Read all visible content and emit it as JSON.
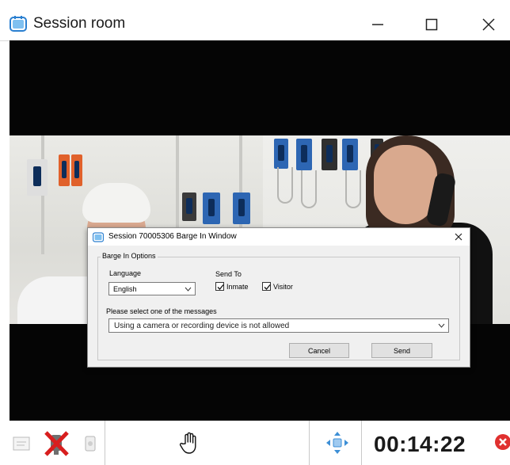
{
  "window": {
    "title": "Session room",
    "minimize_glyph": "—",
    "maximize_glyph": "☐",
    "close_glyph": "✕"
  },
  "dialog": {
    "title": "Session 70005306 Barge In Window",
    "close_glyph": "✕",
    "group_label": "Barge In Options",
    "language_label": "Language",
    "language_value": "English",
    "send_to_label": "Send To",
    "inmate_label": "Inmate",
    "inmate_checked": true,
    "visitor_label": "Visitor",
    "visitor_checked": true,
    "message_prompt": "Please select one of the messages",
    "message_value": "Using a camera or recording device is not allowed",
    "cancel_label": "Cancel",
    "send_label": "Send"
  },
  "toolbar": {
    "timer": "00:14:22",
    "icons": [
      "note-icon",
      "camera-muted-icon",
      "recording-icon",
      "hand-icon",
      "move-arrows-icon",
      "end-session-icon"
    ]
  },
  "colors": {
    "video_bg": "#050505",
    "dialog_bg": "#f0f0f0",
    "end_red": "#e0302f",
    "mute_red": "#d81e1e",
    "move_blue": "#3d8fd6"
  }
}
